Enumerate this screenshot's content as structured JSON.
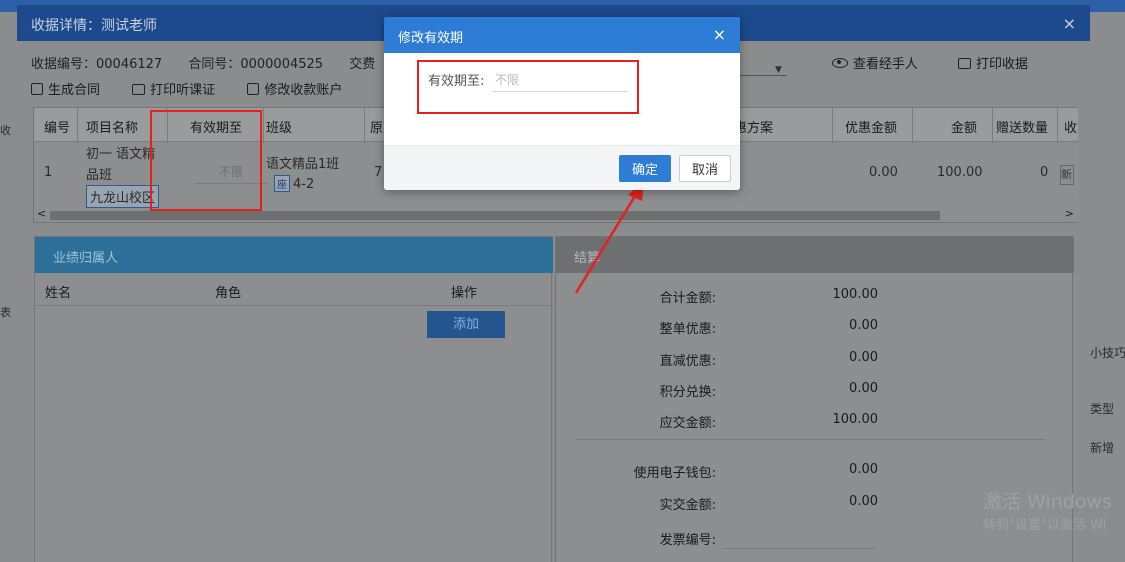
{
  "background": {
    "right_labels": [
      "小技巧",
      "类型",
      "新增"
    ],
    "left_labels": [
      "收",
      "表"
    ]
  },
  "receipt_modal": {
    "title": "收据详情：测试老师",
    "close_icon": "×",
    "receipt_no_label": "收据编号：",
    "receipt_no": "00046127",
    "contract_no_label": "合同号：",
    "contract_no": "0000004525",
    "payment_label": "交费",
    "toolbar": {
      "generate_contract": "生成合同",
      "print_class_voucher": "打印听课证",
      "modify_account": "修改收款账户",
      "view_handler": "查看经手人",
      "print_receipt": "打印收据"
    },
    "table": {
      "columns": [
        "编号",
        "项目名称",
        "有效期至",
        "班级",
        "原",
        "惠方案",
        "优惠金额",
        "金额",
        "赠送数量",
        "收"
      ],
      "row": {
        "no": "1",
        "project_line1": "初一 语文精",
        "project_line2": "品班",
        "campus_tag": "九龙山校区",
        "valid_until_placeholder": "不限",
        "class_line1": "语文精品1班",
        "class_badge": "座",
        "class_line2": "4-2",
        "original_partial": "7",
        "discount_amount": "0.00",
        "amount": "100.00",
        "gift_qty": "0",
        "action_partial": "新"
      }
    },
    "performance": {
      "title": "业绩归属人",
      "col_name": "姓名",
      "col_role": "角色",
      "col_action": "操作",
      "add_button": "添加"
    },
    "settlement": {
      "title": "结算",
      "rows": [
        {
          "label": "合计金额:",
          "value": "100.00"
        },
        {
          "label": "整单优惠:",
          "value": "0.00"
        },
        {
          "label": "直减优惠:",
          "value": "0.00"
        },
        {
          "label": "积分兑换:",
          "value": "0.00"
        },
        {
          "label": "应交金额:",
          "value": "100.00"
        },
        {
          "label": "使用电子钱包:",
          "value": "0.00"
        },
        {
          "label": "实交金额:",
          "value": "0.00"
        },
        {
          "label": "发票编号:",
          "value": ""
        }
      ]
    }
  },
  "watermark": {
    "line1": "激活 Windows",
    "line2": "转到\"设置\"以激活 Wi"
  },
  "dialog": {
    "title": "修改有效期",
    "close_icon": "×",
    "field_label": "有效期至:",
    "field_placeholder": "不限",
    "field_value": "",
    "ok_button": "确定",
    "cancel_button": "取消"
  },
  "colors": {
    "dialog_header": "#2d7dd6",
    "highlight": "#e5211d",
    "primary_button": "#2d7dd6"
  }
}
